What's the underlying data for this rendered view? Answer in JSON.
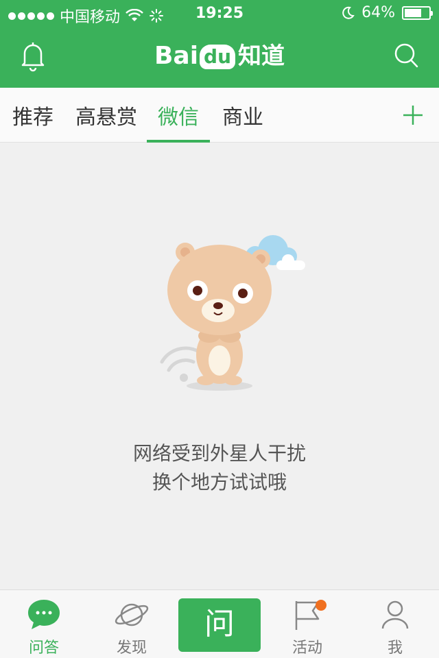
{
  "status": {
    "carrier": "中国移动",
    "time": "19:25",
    "battery": "64%",
    "battery_level": 0.64
  },
  "header": {
    "logo_bai": "Bai",
    "logo_du": "du",
    "logo_zhidao": "知道",
    "icons": [
      "bell-icon",
      "search-icon"
    ]
  },
  "tabs": [
    {
      "label": "推荐",
      "active": false
    },
    {
      "label": "高悬赏",
      "active": false
    },
    {
      "label": "微信",
      "active": true
    },
    {
      "label": "商业",
      "active": false
    }
  ],
  "content": {
    "message_line1": "网络受到外星人干扰",
    "message_line2": "换个地方试试哦"
  },
  "bottom_nav": {
    "items": [
      {
        "label": "问答",
        "icon": "chat-bubble-icon",
        "active": true
      },
      {
        "label": "发现",
        "icon": "planet-icon",
        "active": false
      },
      {
        "label": "活动",
        "icon": "flag-icon",
        "active": false,
        "badge": true
      },
      {
        "label": "我",
        "icon": "person-icon",
        "active": false
      }
    ],
    "ask_label": "问"
  },
  "colors": {
    "brand_green": "#3ab15a",
    "badge_orange": "#f07020",
    "background": "#f0f0f0"
  }
}
